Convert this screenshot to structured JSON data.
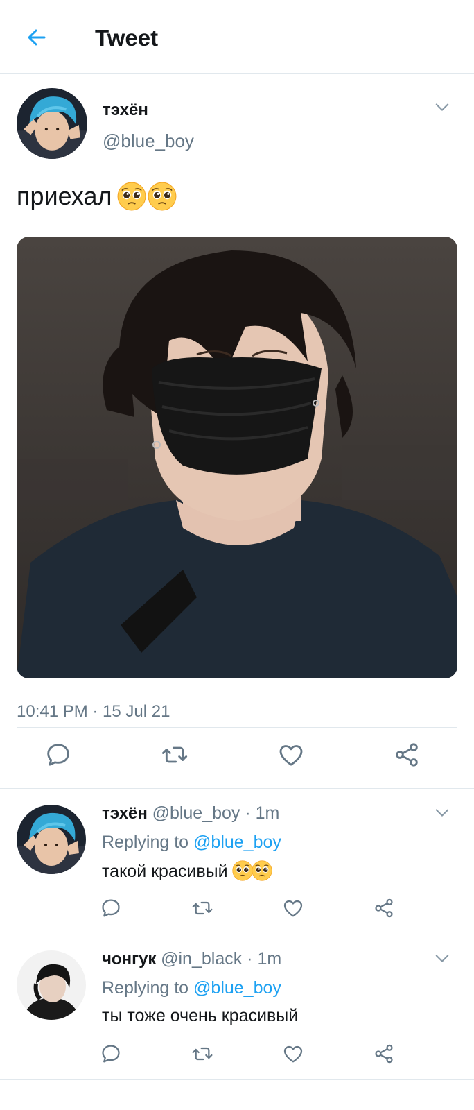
{
  "header": {
    "title": "Tweet",
    "back_icon": "back-arrow-icon",
    "accent": "#1da1f2"
  },
  "tweet": {
    "name": "тэхён",
    "handle": "@blue_boy",
    "text": "приехал",
    "emojis": [
      "pleading-face-icon",
      "pleading-face-icon"
    ],
    "timestamp": "10:41 PM · 15 Jul 21",
    "actions": [
      "reply-icon",
      "retweet-icon",
      "like-icon",
      "share-icon"
    ]
  },
  "replies": [
    {
      "name": "тэхён",
      "meta": "@blue_boy · 1m",
      "replying_prefix": "Replying to",
      "mention": "@blue_boy",
      "text": "такой красивый",
      "emojis": [
        "pleading-face-icon",
        "pleading-face-icon"
      ]
    },
    {
      "name": "чонгук",
      "meta": "@in_black · 1m",
      "replying_prefix": "Replying to",
      "mention": "@blue_boy",
      "text": "ты тоже очень красивый"
    }
  ],
  "colors": {
    "text": "#14171a",
    "secondary": "#657786",
    "link": "#1da1f2",
    "divider": "#e1e8ed"
  }
}
